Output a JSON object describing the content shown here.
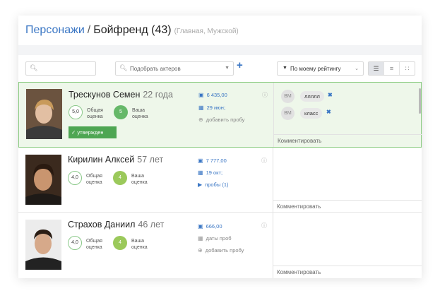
{
  "breadcrumb": {
    "parent": "Персонажи",
    "separator": "/",
    "title": "Бойфренд (43)",
    "subtitle": "(Главная, Мужской)"
  },
  "toolbar": {
    "search_placeholder": "",
    "actor_picker": "Подобрать актеров",
    "add": "+",
    "sort_label": "По моему рейтингу",
    "views": [
      "list-view-icon",
      "compact-list-icon",
      "grid-view-icon"
    ]
  },
  "rows": [
    {
      "name": "Трескунов Семен",
      "age": "22 года",
      "overall_label": "Общая оценка",
      "overall": "5,0",
      "mine_label": "Ваша оценка",
      "mine": "5",
      "approved": "утвержден",
      "fee": "6 435,00",
      "date": "29 июн;",
      "action": "добавить пробу",
      "comments": [
        {
          "avatar": "ВМ",
          "text": "ллллл"
        },
        {
          "avatar": "ВМ",
          "text": "класс"
        }
      ],
      "comment_prompt": "Комментировать"
    },
    {
      "name": "Кирилин Алксей",
      "age": "57 лет",
      "overall_label": "Общая оценка",
      "overall": "4,0",
      "mine_label": "Ваша оценка",
      "mine": "4",
      "fee": "7 777,00",
      "date": "19 окт;",
      "action": "пробы (1)",
      "comment_prompt": "Комментировать"
    },
    {
      "name": "Страхов Даниил",
      "age": "46 лет",
      "overall_label": "Общая оценка",
      "overall": "4,0",
      "mine_label": "Ваша оценка",
      "mine": "4",
      "fee": "666,00",
      "date": "даты проб",
      "action": "добавить пробу",
      "comment_prompt": "Комментировать"
    }
  ],
  "colors": {
    "accent": "#3a76c4",
    "approved": "#4ea653",
    "selected_bg": "#eef7ea",
    "selected_border": "#8acb80"
  }
}
